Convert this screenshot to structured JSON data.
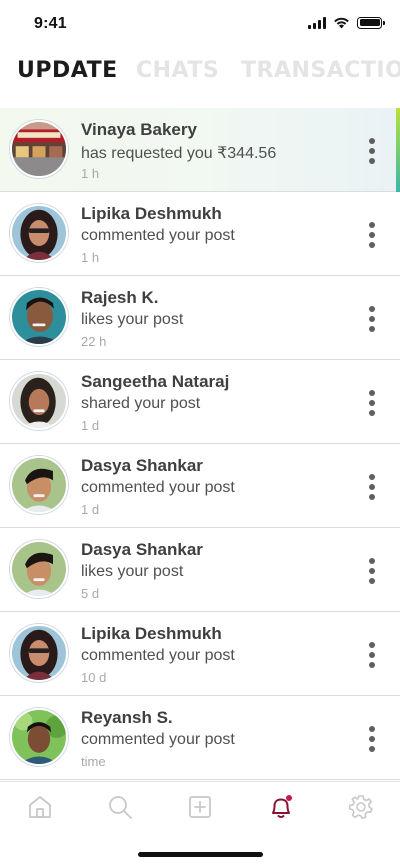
{
  "status_bar": {
    "time": "9:41",
    "icons": [
      "cellular-signal-icon",
      "wifi-icon",
      "battery-icon"
    ]
  },
  "tabs": [
    {
      "label": "UPDATE",
      "active": true
    },
    {
      "label": "CHATS",
      "active": false
    },
    {
      "label": "TRANSACTIONS",
      "active": false
    }
  ],
  "notifications": [
    {
      "name": "Vinaya Bakery",
      "action": "has requested you ₹344.56",
      "time": "1 h",
      "highlighted": true
    },
    {
      "name": "Lipika Deshmukh",
      "action": "commented your post",
      "time": "1 h",
      "highlighted": false
    },
    {
      "name": "Rajesh K.",
      "action": "likes your post",
      "time": "22 h",
      "highlighted": false
    },
    {
      "name": "Sangeetha Nataraj",
      "action": "shared your post",
      "time": "1 d",
      "highlighted": false
    },
    {
      "name": "Dasya Shankar",
      "action": "commented your post",
      "time": "1 d",
      "highlighted": false
    },
    {
      "name": "Dasya Shankar",
      "action": "likes your post",
      "time": "5 d",
      "highlighted": false
    },
    {
      "name": "Lipika Deshmukh",
      "action": "commented your post",
      "time": "10 d",
      "highlighted": false
    },
    {
      "name": "Reyansh S.",
      "action": "commented your post",
      "time": "time",
      "highlighted": false
    }
  ],
  "bottom_nav": [
    {
      "icon": "home-icon",
      "active": false
    },
    {
      "icon": "search-icon",
      "active": false
    },
    {
      "icon": "add-post-icon",
      "active": false
    },
    {
      "icon": "notification-bell-icon",
      "active": true
    },
    {
      "icon": "settings-gear-icon",
      "active": false
    }
  ],
  "colors": {
    "active_nav": "#8a1230",
    "inactive_nav": "#c8c8c8",
    "tab_active": "#1c1c1c",
    "tab_inactive": "#e4e4e4",
    "highlight_accent_top": "#b7e23a",
    "highlight_accent_bottom": "#3bb6a8"
  }
}
